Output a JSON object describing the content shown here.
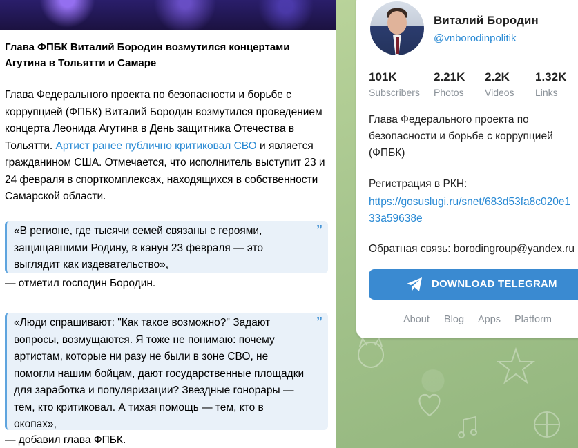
{
  "post": {
    "title": "Глава ФПБК Виталий Бородин возмутился концертами Агутина в Тольятти и Самаре",
    "body_part1": "Глава Федерального проекта по безопасности и борьбе с коррупцией (ФПБК) Виталий Бородин возмутился проведением концерта Леонида Агутина в День защитника Отечества в Тольятти. ",
    "body_link": "Артист ранее публично критиковал СВО",
    "body_part2": " и является гражданином США. Отмечается, что исполнитель выступит 23 и 24 февраля в спорткомплексах, находящихся в собственности Самарской области.",
    "quote1": "«В регионе, где тысячи семей связаны с героями, защищавшими Родину, в канун 23 февраля — это выглядит как издевательство»,",
    "attrib1": "— отметил господин Бородин.",
    "quote2": "«Люди спрашивают: \"Как такое возможно?\" Задают вопросы, возмущаются. Я тоже не понимаю: почему артистам, которые ни разу не были в зоне СВО, не помогли нашим бойцам, дают государственные площадки для заработка и популяризации? Звездные гонорары — тем, кто критиковал. А тихая помощь — тем, кто в окопах»,",
    "attrib2": "— добавил глава ФПБК.",
    "quote_mark": "”"
  },
  "channel": {
    "name": "Виталий Бородин",
    "handle": "@vnborodinpolitik",
    "stats": [
      {
        "value": "101K",
        "label": "Subscribers"
      },
      {
        "value": "2.21K",
        "label": "Photos"
      },
      {
        "value": "2.2K",
        "label": "Videos"
      },
      {
        "value": "1.32K",
        "label": "Links"
      }
    ],
    "description": "Глава Федерального проекта по безопасности и борьбе с коррупцией (ФПБК)",
    "rkn_label": "Регистрация в РКН:",
    "rkn_link_line1": "https://gosuslugi.ru/snet/683d53fa8c020e1",
    "rkn_link_line2": "33a59638e",
    "feedback": "Обратная связь: borodingroup@yandex.ru",
    "download_button": "DOWNLOAD TELEGRAM",
    "footer": [
      "About",
      "Blog",
      "Apps",
      "Platform"
    ]
  },
  "colors": {
    "accent": "#3a8ad1",
    "link": "#2a8ad4",
    "background": "#a9c790",
    "muted": "#8b9299"
  }
}
